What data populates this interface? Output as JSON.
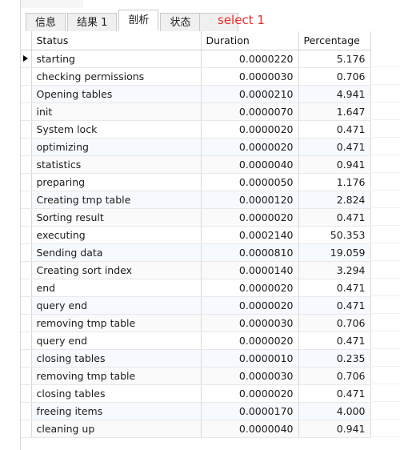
{
  "window": {
    "annotation": "select 1"
  },
  "tabs": [
    {
      "label": "信息",
      "active": false
    },
    {
      "label": "结果 1",
      "active": false
    },
    {
      "label": "剖析",
      "active": true
    },
    {
      "label": "状态",
      "active": false
    }
  ],
  "grid": {
    "columns": [
      "Status",
      "Duration",
      "Percentage"
    ],
    "selected_row_index": 0,
    "rows": [
      {
        "status": "starting",
        "duration": "0.0000220",
        "percentage": "5.176"
      },
      {
        "status": "checking permissions",
        "duration": "0.0000030",
        "percentage": "0.706"
      },
      {
        "status": "Opening tables",
        "duration": "0.0000210",
        "percentage": "4.941"
      },
      {
        "status": "init",
        "duration": "0.0000070",
        "percentage": "1.647"
      },
      {
        "status": "System lock",
        "duration": "0.0000020",
        "percentage": "0.471"
      },
      {
        "status": "optimizing",
        "duration": "0.0000020",
        "percentage": "0.471"
      },
      {
        "status": "statistics",
        "duration": "0.0000040",
        "percentage": "0.941"
      },
      {
        "status": "preparing",
        "duration": "0.0000050",
        "percentage": "1.176"
      },
      {
        "status": "Creating tmp table",
        "duration": "0.0000120",
        "percentage": "2.824"
      },
      {
        "status": "Sorting result",
        "duration": "0.0000020",
        "percentage": "0.471"
      },
      {
        "status": "executing",
        "duration": "0.0002140",
        "percentage": "50.353"
      },
      {
        "status": "Sending data",
        "duration": "0.0000810",
        "percentage": "19.059"
      },
      {
        "status": "Creating sort index",
        "duration": "0.0000140",
        "percentage": "3.294"
      },
      {
        "status": "end",
        "duration": "0.0000020",
        "percentage": "0.471"
      },
      {
        "status": "query end",
        "duration": "0.0000020",
        "percentage": "0.471"
      },
      {
        "status": "removing tmp table",
        "duration": "0.0000030",
        "percentage": "0.706"
      },
      {
        "status": "query end",
        "duration": "0.0000020",
        "percentage": "0.471"
      },
      {
        "status": "closing tables",
        "duration": "0.0000010",
        "percentage": "0.235"
      },
      {
        "status": "removing tmp table",
        "duration": "0.0000030",
        "percentage": "0.706"
      },
      {
        "status": "closing tables",
        "duration": "0.0000020",
        "percentage": "0.471"
      },
      {
        "status": "freeing items",
        "duration": "0.0000170",
        "percentage": "4.000"
      },
      {
        "status": "cleaning up",
        "duration": "0.0000040",
        "percentage": "0.941"
      }
    ]
  },
  "colors": {
    "annotation": "#ef2a2a",
    "stripe_blue": "#f6f9fd",
    "stripe_gray": "#fafafa",
    "grid_line": "#d9d9d9"
  }
}
